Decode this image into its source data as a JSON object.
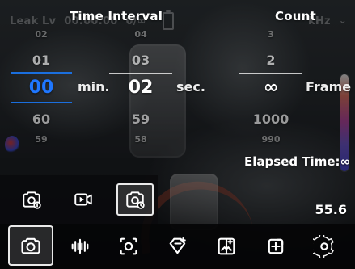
{
  "status_ghost": {
    "left_text": "Leak Lv",
    "timer_text": "00:00:00",
    "count_text": "0/∞",
    "freq_text": "kHz"
  },
  "header": {
    "time_interval_label": "Time Interval",
    "count_label": "Count"
  },
  "pickers": {
    "minutes": {
      "above2": "02",
      "above1": "01",
      "selected": "00",
      "below1": "60",
      "below2": "59",
      "unit": "min."
    },
    "seconds": {
      "above2": "04",
      "above1": "03",
      "selected": "02",
      "below1": "59",
      "below2": "58",
      "unit": "sec."
    },
    "frames": {
      "above2": "3",
      "above1": "2",
      "selected": "∞",
      "below1": "1000",
      "below2": "990",
      "unit": "Frame"
    }
  },
  "elapsed": {
    "text": "Elapsed Time:∞"
  },
  "modes": {
    "items": [
      {
        "name": "photo-info-mode",
        "icon": "camera-info-icon",
        "selected": false
      },
      {
        "name": "video-mode",
        "icon": "video-icon",
        "selected": false
      },
      {
        "name": "timelapse-mode",
        "icon": "camera-timer-icon",
        "selected": true
      }
    ]
  },
  "preview": {
    "value_text": "55.6"
  },
  "toolbar": {
    "items": [
      {
        "name": "camera-button",
        "icon": "camera-icon",
        "active": true
      },
      {
        "name": "audio-button",
        "icon": "waveform-icon",
        "active": false
      },
      {
        "name": "focus-button",
        "icon": "focus-icon",
        "active": false
      },
      {
        "name": "add-tag-button",
        "icon": "tag-add-icon",
        "active": false
      },
      {
        "name": "compare-button",
        "icon": "compare-icon",
        "active": false
      },
      {
        "name": "export-button",
        "icon": "export-icon",
        "active": false
      },
      {
        "name": "settings-button",
        "icon": "gear-icon",
        "active": false
      }
    ]
  },
  "colors": {
    "accent_blue": "#1f77ff"
  }
}
